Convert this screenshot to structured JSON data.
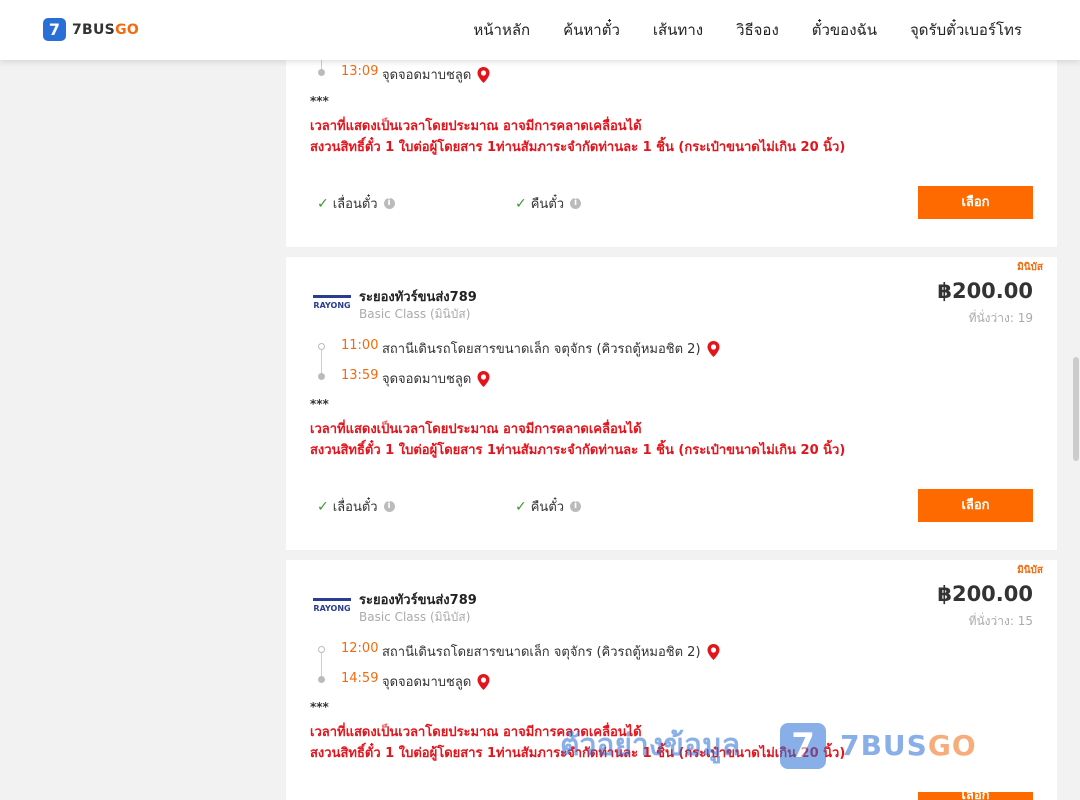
{
  "header": {
    "logo_mark": "7",
    "logo_text_main": "7BUS",
    "logo_text_go": "GO",
    "nav": [
      "หน้าหลัก",
      "ค้นหาตั๋ว",
      "เส้นทาง",
      "วิธีจอง",
      "ตั๋วของฉัน",
      "จุดรับตั๋วเบอร์โทร"
    ]
  },
  "common": {
    "stars": "***",
    "note_line1": "เวลาที่แสดงเป็นเวลาโดยประมาณ อาจมีการคลาดเคลื่อนได้",
    "note_line2": "สงวนสิทธิ์ตั๋ว 1 ใบต่อผู้โดยสาร 1ท่านสัมภาระจำกัดท่านละ 1 ชิ้น (กระเป๋าขนาดไม่เกิน 20 นิ้ว)",
    "reschedule": "เลื่อนตั๋ว",
    "refund": "คืนตั๋ว",
    "info_glyph": "i",
    "check_glyph": "✓",
    "select_label": "เลือก"
  },
  "card0": {
    "arrive_time": "13:09",
    "arrive_place": "จุดจอดมาบชลูด"
  },
  "card1": {
    "tag": "มินิบัส",
    "operator": "ระยองทัวร์ขนส่ง789",
    "operator_logo": "RAYONG",
    "class": "Basic Class (มินิบัส)",
    "price": "฿200.00",
    "seats": "ที่นั่งว่าง: 19",
    "depart_time": "11:00",
    "depart_place": "สถานีเดินรถโดยสารขนาดเล็ก จตุจักร (คิวรถตู้หมอชิต 2)",
    "arrive_time": "13:59",
    "arrive_place": "จุดจอดมาบชลูด"
  },
  "card2": {
    "tag": "มินิบัส",
    "operator": "ระยองทัวร์ขนส่ง789",
    "operator_logo": "RAYONG",
    "class": "Basic Class (มินิบัส)",
    "price": "฿200.00",
    "seats": "ที่นั่งว่าง: 15",
    "depart_time": "12:00",
    "depart_place": "สถานีเดินรถโดยสารขนาดเล็ก จตุจักร (คิวรถตู้หมอชิต 2)",
    "arrive_time": "14:59",
    "arrive_place": "จุดจอดมาบชลูด"
  },
  "watermark": {
    "text": "ตัวอย่างข้อมูล",
    "mark": "7",
    "brand_main": "7BUS",
    "brand_go": "GO"
  },
  "colors": {
    "accent": "#ff6a00",
    "brand_blue": "#2a6fd6",
    "note_red": "#e3141c",
    "time_orange": "#f26b0f"
  }
}
